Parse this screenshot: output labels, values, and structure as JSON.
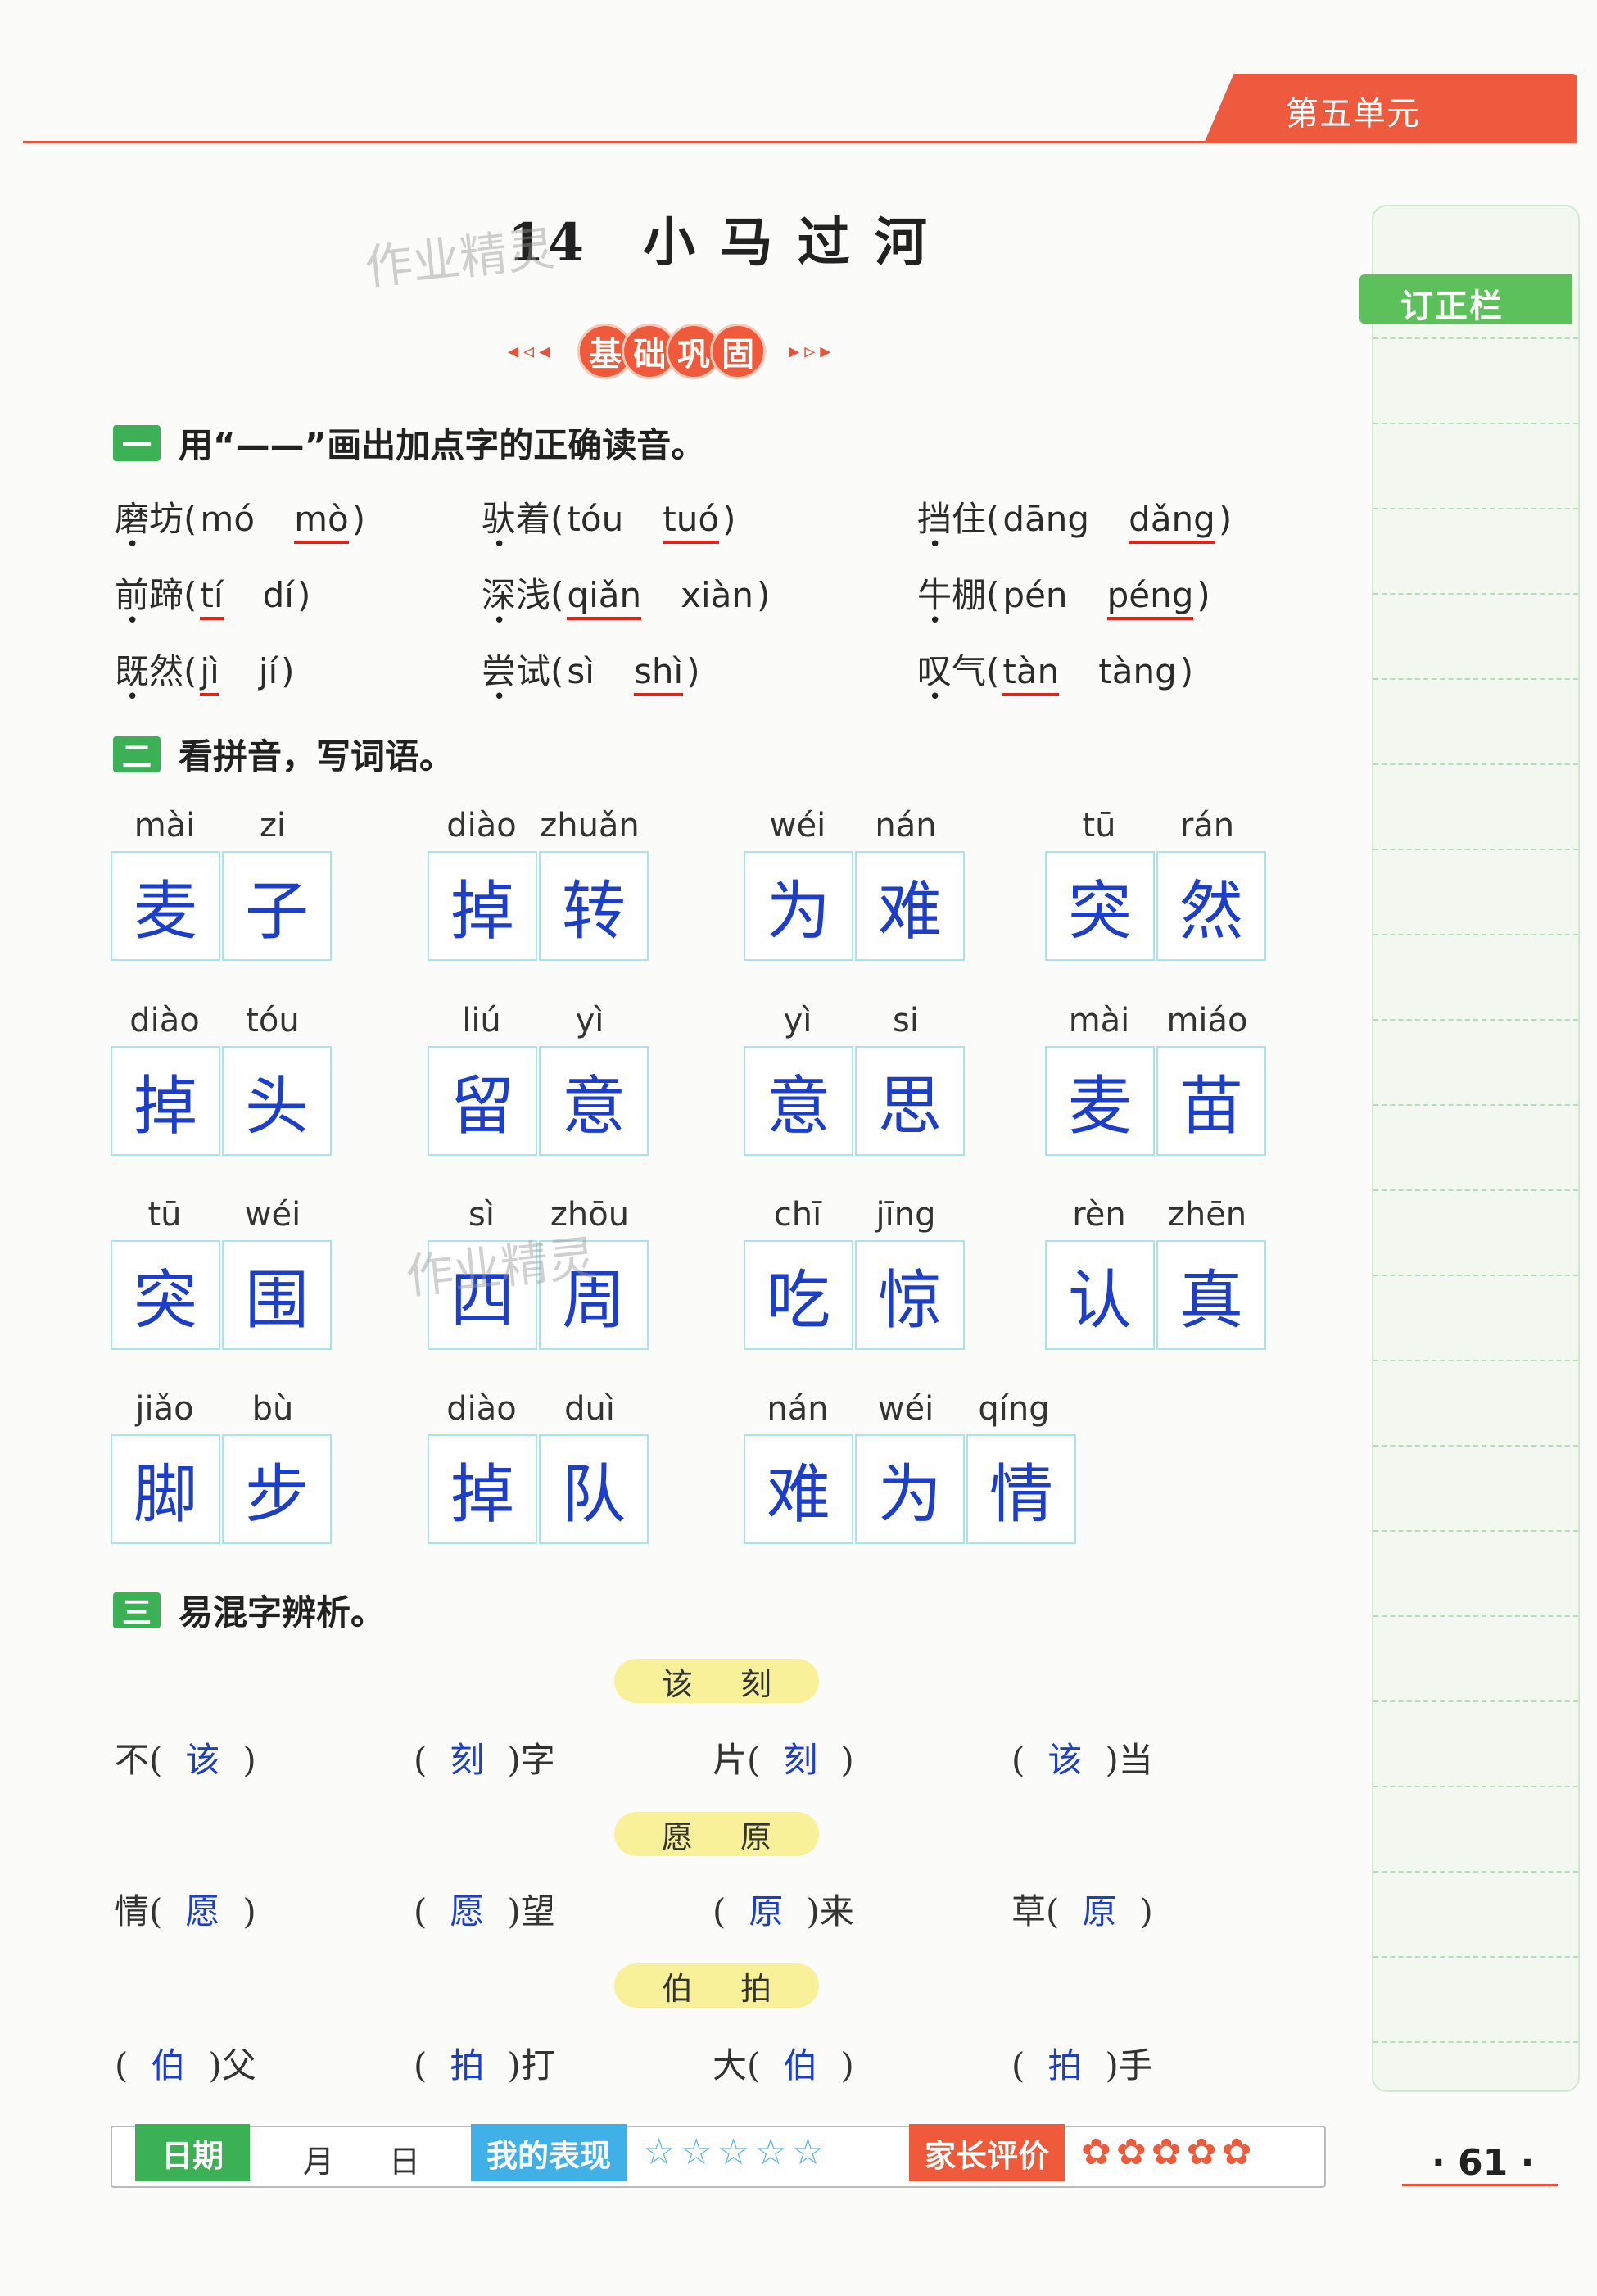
{
  "header": {
    "unit_tab": "第五单元"
  },
  "lesson": {
    "title": "14　小 马 过 河",
    "watermark": "作业精灵"
  },
  "banner": {
    "left_arrows": "◂◃◂",
    "chars": [
      "基",
      "础",
      "巩",
      "固"
    ],
    "right_arrows": "▸▹▸"
  },
  "q1": {
    "num": "一",
    "instruction": "用“——”画出加点字的正确读音。",
    "items": [
      {
        "word": "磨坊",
        "opts": [
          "mó",
          "mò"
        ],
        "correct": 1
      },
      {
        "word": "驮着",
        "opts": [
          "tóu",
          "tuó"
        ],
        "correct": 1
      },
      {
        "word": "挡住",
        "opts": [
          "dāng",
          "dǎng"
        ],
        "correct": 1
      },
      {
        "word": "前蹄",
        "opts": [
          "tí",
          "dí"
        ],
        "correct": 0
      },
      {
        "word": "深浅",
        "opts": [
          "qiǎn",
          "xiàn"
        ],
        "correct": 0
      },
      {
        "word": "牛棚",
        "opts": [
          "pén",
          "péng"
        ],
        "correct": 1
      },
      {
        "word": "既然",
        "opts": [
          "jì",
          "jí"
        ],
        "correct": 0
      },
      {
        "word": "尝试",
        "opts": [
          "sì",
          "shì"
        ],
        "correct": 1
      },
      {
        "word": "叹气",
        "opts": [
          "tàn",
          "tàng"
        ],
        "correct": 0
      }
    ]
  },
  "q2": {
    "num": "二",
    "instruction": "看拼音，写词语。",
    "words": [
      {
        "py": [
          "mài",
          "zi"
        ],
        "hz": [
          "麦",
          "子"
        ]
      },
      {
        "py": [
          "diào",
          "zhuǎn"
        ],
        "hz": [
          "掉",
          "转"
        ]
      },
      {
        "py": [
          "wéi",
          "nán"
        ],
        "hz": [
          "为",
          "难"
        ]
      },
      {
        "py": [
          "tū",
          "rán"
        ],
        "hz": [
          "突",
          "然"
        ]
      },
      {
        "py": [
          "diào",
          "tóu"
        ],
        "hz": [
          "掉",
          "头"
        ]
      },
      {
        "py": [
          "liú",
          "yì"
        ],
        "hz": [
          "留",
          "意"
        ]
      },
      {
        "py": [
          "yì",
          "si"
        ],
        "hz": [
          "意",
          "思"
        ]
      },
      {
        "py": [
          "mài",
          "miáo"
        ],
        "hz": [
          "麦",
          "苗"
        ]
      },
      {
        "py": [
          "tū",
          "wéi"
        ],
        "hz": [
          "突",
          "围"
        ]
      },
      {
        "py": [
          "sì",
          "zhōu"
        ],
        "hz": [
          "四",
          "周"
        ]
      },
      {
        "py": [
          "chī",
          "jīng"
        ],
        "hz": [
          "吃",
          "惊"
        ]
      },
      {
        "py": [
          "rèn",
          "zhēn"
        ],
        "hz": [
          "认",
          "真"
        ]
      },
      {
        "py": [
          "jiǎo",
          "bù"
        ],
        "hz": [
          "脚",
          "步"
        ]
      },
      {
        "py": [
          "diào",
          "duì"
        ],
        "hz": [
          "掉",
          "队"
        ]
      },
      {
        "py": [
          "nán",
          "wéi",
          "qíng"
        ],
        "hz": [
          "难",
          "为",
          "情"
        ]
      }
    ]
  },
  "q3": {
    "num": "三",
    "instruction": "易混字辨析。",
    "groups": [
      {
        "pair": [
          "该",
          "刻"
        ],
        "items": [
          {
            "pre": "不(",
            "ans": "该",
            "post": ")"
          },
          {
            "pre": "(",
            "ans": "刻",
            "post": ")字"
          },
          {
            "pre": "片(",
            "ans": "刻",
            "post": ")"
          },
          {
            "pre": "(",
            "ans": "该",
            "post": ")当"
          }
        ]
      },
      {
        "pair": [
          "愿",
          "原"
        ],
        "items": [
          {
            "pre": "情(",
            "ans": "愿",
            "post": ")"
          },
          {
            "pre": "(",
            "ans": "愿",
            "post": ")望"
          },
          {
            "pre": "(",
            "ans": "原",
            "post": ")来"
          },
          {
            "pre": "草(",
            "ans": "原",
            "post": ")"
          }
        ]
      },
      {
        "pair": [
          "伯",
          "拍"
        ],
        "items": [
          {
            "pre": "(",
            "ans": "伯",
            "post": ")父"
          },
          {
            "pre": "(",
            "ans": "拍",
            "post": ")打"
          },
          {
            "pre": "大(",
            "ans": "伯",
            "post": ")"
          },
          {
            "pre": "(",
            "ans": "拍",
            "post": ")手"
          }
        ]
      }
    ]
  },
  "sidebar": {
    "revision_label": "订正栏"
  },
  "footer": {
    "date_label": "日期",
    "month": "月",
    "day": "日",
    "performance_label": "我的表现",
    "performance_stars": "☆☆☆☆☆",
    "parent_label": "家长评价",
    "parent_flowers": "✿✿✿✿✿"
  },
  "page_number": "· 61 ·",
  "colors": {
    "accent": "#ee5a3e",
    "green": "#3cb054",
    "answer_blue": "#1d3fc8",
    "underline_red": "#d9261c",
    "pill_yellow": "#f8f19a"
  }
}
